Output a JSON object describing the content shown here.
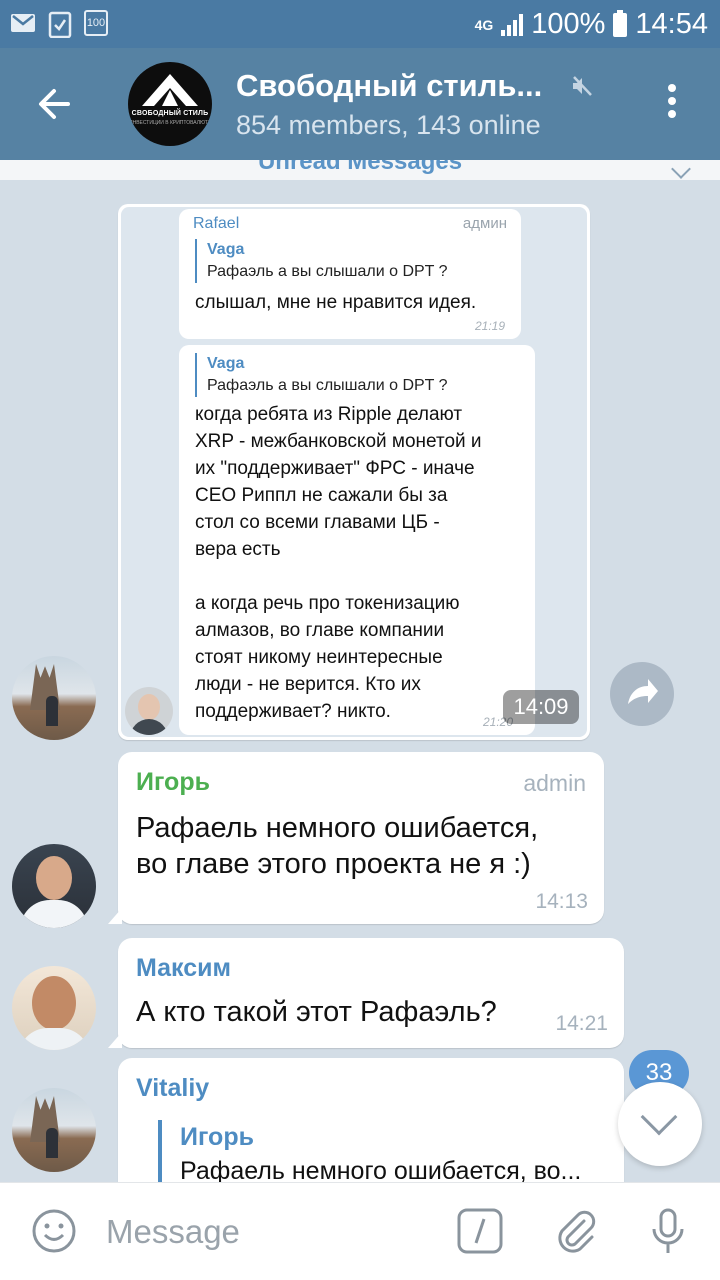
{
  "status_bar": {
    "network": "4G",
    "battery": "100%",
    "time": "14:54",
    "notif_icon_label": "100"
  },
  "header": {
    "title": "Свободный стиль...",
    "subtitle": "854 members, 143 online",
    "avatar_logo_text": "СВОБОДНЫЙ СТИЛЬ",
    "avatar_logo_subtext": "ИНВЕСТИЦИИ В КРИПТОВАЛЮТУ"
  },
  "unread_label": "Unread Messages",
  "screenshot_message": {
    "time": "14:09",
    "inner": [
      {
        "sender": "Rafael",
        "role": "админ",
        "reply_name": "Vaga",
        "reply_text": "Рафаэль а вы слышали о DPT ?",
        "text": "слышал, мне не нравится идея.",
        "time": "21:19"
      },
      {
        "reply_name": "Vaga",
        "reply_text": "Рафаэль а вы слышали о DPT ?",
        "lines": [
          "когда ребята из Ripple делают",
          "XRP - межбанковской монетой и",
          "их \"поддерживает\" ФРС - иначе",
          "CEO Риппл не сажали бы за",
          "стол со всеми главами ЦБ -",
          "вера есть",
          "",
          "а когда речь про токенизацию",
          "алмазов, во главе компании",
          "стоят никому неинтересные",
          "люди - не верится. Кто их",
          "поддерживает? никто."
        ],
        "time": "21:20"
      }
    ]
  },
  "messages": [
    {
      "sender": "Игорь",
      "sender_color": "#4caf50",
      "role": "admin",
      "lines": [
        "Рафаель немного ошибается,",
        "во главе этого проекта не я :)"
      ],
      "time": "14:13"
    },
    {
      "sender": "Максим",
      "sender_color": "#4e8cc2",
      "text": "А кто такой этот Рафаэль?",
      "time": "14:21"
    },
    {
      "sender": "Vitaliy",
      "sender_color": "#4e8cc2",
      "reply_name": "Игорь",
      "reply_text": "Рафаель немного ошибается, во..."
    }
  ],
  "unread_count": "33",
  "input": {
    "placeholder": "Message"
  },
  "colors": {
    "header_bg": "#5682a3",
    "status_bg": "#4a7aa3",
    "accent": "#4e8cc2"
  }
}
